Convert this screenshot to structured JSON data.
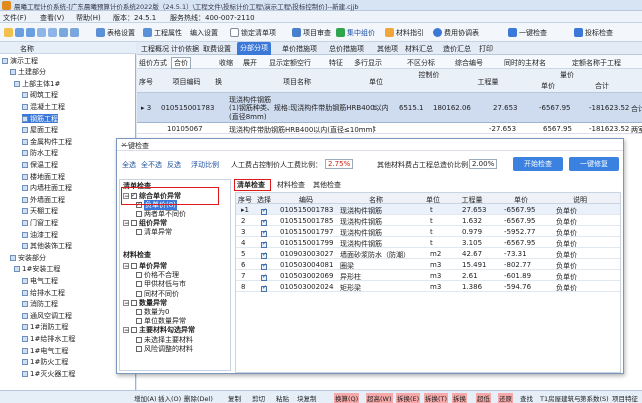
{
  "app": {
    "title": "晨曦工程计价系统-[广东晨曦预算计价系统2022版（24.5.1）\\工程文件\\投标计价工程\\演示工程\\投标控制价]--新建.cjjb"
  },
  "menu": [
    "文件(F)",
    "查看(V)",
    "帮助(H)",
    "版本：24.5.1",
    "服务热线：400-007-2110"
  ],
  "toolbar": {
    "items": [
      "表格设置",
      "工程属性",
      "编入设置",
      "锁定清单项",
      "项目审查",
      "集中组价",
      "材料指引",
      "费用协调表",
      "一键检查",
      "投标检查"
    ]
  },
  "left": {
    "head": "名称",
    "tree": [
      "演示工程",
      "土建部分",
      "上部主体1#",
      "砌筑工程",
      "混凝土工程",
      "钢筋工程",
      "屋面工程",
      "金属构件工程",
      "防水工程",
      "保温工程",
      "楼地面工程",
      "内墙柱面工程",
      "外墙面工程",
      "天棚工程",
      "门窗工程",
      "油漆工程",
      "其他装饰工程",
      "安装部分",
      "1#安装工程",
      "电气工程",
      "给排水工程",
      "消防工程",
      "通风空调工程",
      "1#消防工程",
      "1#给排水工程",
      "1#电气工程",
      "1#防火工程",
      "1#灭火器工程"
    ]
  },
  "tabs": [
    "工程概况",
    "计价依据",
    "取费设置",
    "分部分项",
    "单价措施项",
    "总价措施项",
    "其他项",
    "材料汇总",
    "造价汇总",
    "打印"
  ],
  "active_tab": "分部分项",
  "filter": {
    "label": "组价方式",
    "value": "合价",
    "items": [
      "收缩",
      "展开",
      "显示定额空行",
      "特征",
      "多行显示",
      "不区分标",
      "综合编号",
      "同时的主材名",
      "定额名称于工程"
    ]
  },
  "grid": {
    "headers": [
      "序号",
      "项目编码",
      "换",
      "项目名称",
      "单位",
      "控制价",
      "工程量",
      "合计",
      "单价",
      "控制价单价",
      "工程量",
      "合计"
    ],
    "group_label": "量价",
    "rows": [
      {
        "seq": "3",
        "code": "010515001783",
        "name": "现浇构件钢筋\n(1)钢筋种类、规格:现浇构件带肋钢筋HRB400以内(直径8mm)",
        "unit": "t",
        "price": "6515.1",
        "total": "180162.06",
        "qty": "27.653",
        "unit_price": "-6567.95",
        "sum": "-181623.52",
        "note": "合计"
      },
      {
        "seq": "",
        "code": "10105067",
        "name": "现浇构件带肋钢筋HRB400以内(直径≤10mm)",
        "unit": "t",
        "price": "",
        "total": "",
        "qty": "-27.653",
        "unit_price": "6567.95",
        "sum": "-181623.52",
        "note": "两室"
      }
    ]
  },
  "dialog": {
    "title": "一键检查",
    "close": "×",
    "actions": [
      "全选",
      "全不选",
      "反选",
      "浮动比例"
    ],
    "labor_label": "人工费占控制价人工费比例：",
    "labor_val": "2.75%",
    "material_label": "其他材料费占工程总造价比例：",
    "material_val": "2.00%",
    "btn_start": "开始检查",
    "btn_fix": "一键修复",
    "left_title": "清单检查",
    "checks": [
      {
        "label": "综合单价异常",
        "lvl": 1,
        "on": true,
        "bold": true
      },
      {
        "label": "负单价(8)",
        "lvl": 2,
        "on": true
      },
      {
        "label": "两者单不同价",
        "lvl": 2,
        "on": false
      },
      {
        "label": "组价异常",
        "lvl": 1,
        "on": false,
        "bold": true
      },
      {
        "label": "清单异常",
        "lvl": 2,
        "on": false
      }
    ],
    "mat_title": "材料检查",
    "mat_checks": [
      {
        "label": "单价异常",
        "lvl": 1,
        "bold": true
      },
      {
        "label": "价格不合理",
        "lvl": 2
      },
      {
        "label": "甲供材低与市",
        "lvl": 2
      },
      {
        "label": "同材不同价",
        "lvl": 2
      },
      {
        "label": "数量异常",
        "lvl": 1,
        "bold": true
      },
      {
        "label": "数量为0",
        "lvl": 2
      },
      {
        "label": "单位数量异常",
        "lvl": 2
      },
      {
        "label": "主要材料勾选异常",
        "lvl": 1,
        "bold": true
      },
      {
        "label": "未选择主要材料",
        "lvl": 2
      },
      {
        "label": "风险调整的材料",
        "lvl": 2
      }
    ],
    "subtabs": [
      "清单检查",
      "材料检查",
      "其他检查"
    ],
    "dheaders": [
      "序号",
      "选择",
      "编码",
      "名称",
      "单位",
      "工程量",
      "单价",
      "说明"
    ],
    "drows": [
      {
        "n": "1",
        "code": "010515001783",
        "name": "现浇构件钢筋",
        "unit": "t",
        "qty": "27.653",
        "price": "-6567.95",
        "desc": "负单价"
      },
      {
        "n": "2",
        "code": "010515001785",
        "name": "现浇构件钢筋",
        "unit": "t",
        "qty": "1.632",
        "price": "-6567.95",
        "desc": "负单价"
      },
      {
        "n": "3",
        "code": "010515001797",
        "name": "现浇构件钢筋",
        "unit": "t",
        "qty": "0.979",
        "price": "-5952.77",
        "desc": "负单价"
      },
      {
        "n": "4",
        "code": "010515001799",
        "name": "现浇构件钢筋",
        "unit": "t",
        "qty": "3.105",
        "price": "-6567.95",
        "desc": "负单价"
      },
      {
        "n": "5",
        "code": "010903003027",
        "name": "墙面砂浆防水（防潮）",
        "unit": "m2",
        "qty": "42.67",
        "price": "-73.31",
        "desc": "负单价"
      },
      {
        "n": "6",
        "code": "010503004081",
        "name": "圈梁",
        "unit": "m3",
        "qty": "15.491",
        "price": "-802.77",
        "desc": "负单价"
      },
      {
        "n": "7",
        "code": "010503002069",
        "name": "异形柱",
        "unit": "m3",
        "qty": "2.61",
        "price": "-601.89",
        "desc": "负单价"
      },
      {
        "n": "8",
        "code": "010503002024",
        "name": "矩形梁",
        "unit": "m3",
        "qty": "1.386",
        "price": "-594.76",
        "desc": "负单价"
      }
    ]
  },
  "bottom": [
    "增加(A)",
    "插入(O)",
    "删除(Del)",
    "复制",
    "剪切",
    "粘贴",
    "块复制",
    "换算(Q)",
    "超高(W)",
    "拆换(E)",
    "拆换(T)",
    "拆换",
    "超低",
    "还原",
    "查找",
    "T1房屋建筑与",
    "第系数(S)",
    "项目特征"
  ],
  "colors": {
    "accent": "#3b78d8",
    "highlight": "#e01818"
  }
}
